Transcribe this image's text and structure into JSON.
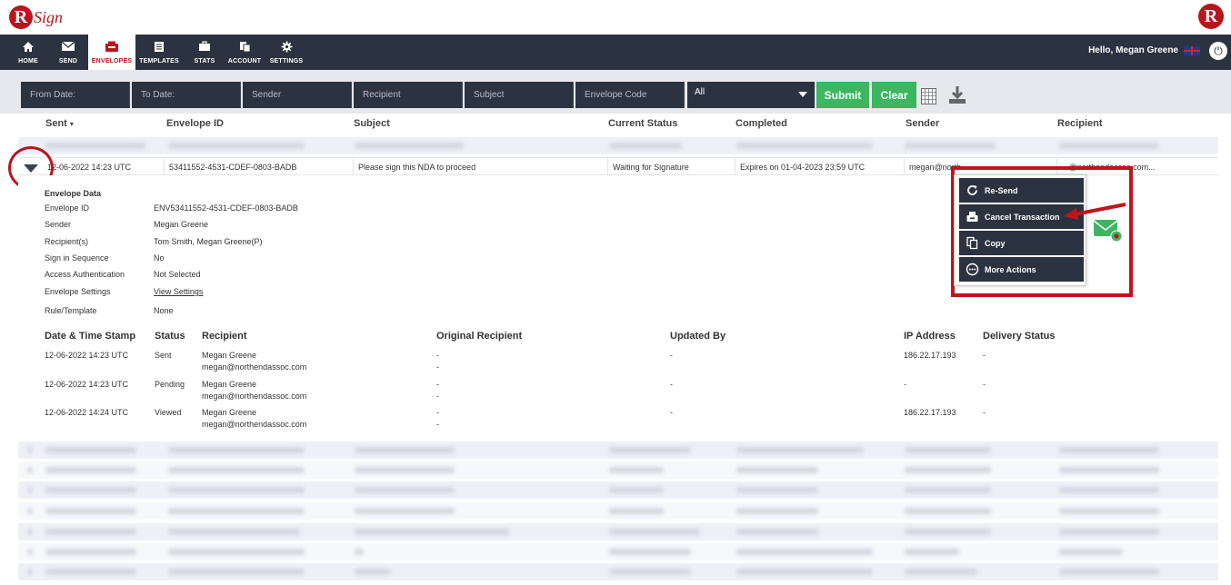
{
  "brand": {
    "logo_letter": "R",
    "logo_word": "Sign",
    "right_logo_letter": "R"
  },
  "nav": {
    "items": [
      {
        "label": "HOME",
        "icon": "home-icon"
      },
      {
        "label": "SEND",
        "icon": "envelope-icon"
      },
      {
        "label": "ENVELOPES",
        "icon": "inbox-icon"
      },
      {
        "label": "TEMPLATES",
        "icon": "document-icon"
      },
      {
        "label": "STATS",
        "icon": "briefcase-icon"
      },
      {
        "label": "ACCOUNT",
        "icon": "copy-icon"
      },
      {
        "label": "SETTINGS",
        "icon": "gear-icon"
      }
    ],
    "active_index": 2,
    "greeting": "Hello, Megan Greene"
  },
  "filters": {
    "from_date": "From Date:",
    "to_date": "To Date:",
    "sender": "Sender",
    "recipient": "Recipient",
    "subject": "Subject",
    "envelope_code": "Envelope Code",
    "status_select": "All",
    "submit_label": "Submit",
    "clear_label": "Clear"
  },
  "table": {
    "columns": [
      "Sent",
      "Envelope ID",
      "Subject",
      "Current Status",
      "Completed",
      "Sender",
      "Recipient"
    ],
    "row": {
      "sent": "12-06-2022 14:23 UTC",
      "envelope_id": "53411552-4531-CDEF-0803-BADB",
      "subject": "Please sign this NDA to proceed",
      "status": "Waiting for Signature",
      "completed": "Expires on 01-04-2023 23:59 UTC",
      "sender": "megan@north",
      "recipient": "...@northendassoc.com..."
    }
  },
  "envelope_data": {
    "title": "Envelope Data",
    "fields": [
      {
        "label": "Envelope ID",
        "value": "ENV53411552-4531-CDEF-0803-BADB"
      },
      {
        "label": "Sender",
        "value": "Megan Greene"
      },
      {
        "label": "Recipient(s)",
        "value": "Tom Smith, Megan Greene(P)"
      },
      {
        "label": "Sign in Sequence",
        "value": "No"
      },
      {
        "label": "Access Authentication",
        "value": "Not Selected"
      },
      {
        "label": "Envelope Settings",
        "value": "View Settings"
      },
      {
        "label": "Rule/Template",
        "value": "None"
      }
    ]
  },
  "history": {
    "columns": [
      "Date & Time Stamp",
      "Status",
      "Recipient",
      "Original Recipient",
      "Updated By",
      "IP Address",
      "Delivery Status"
    ],
    "rows": [
      {
        "time": "12-06-2022 14:23 UTC",
        "status": "Sent",
        "name": "Megan Greene",
        "email": "megan@northendassoc.com",
        "orig1": "-",
        "orig2": "-",
        "updated": "-",
        "ip": "186.22.17.193",
        "delivery": "-"
      },
      {
        "time": "12-06-2022 14:23 UTC",
        "status": "Pending",
        "name": "Megan Greene",
        "email": "megan@northendassoc.com",
        "orig1": "-",
        "orig2": "-",
        "updated": "-",
        "ip": "-",
        "delivery": "-"
      },
      {
        "time": "12-06-2022 14:24 UTC",
        "status": "Viewed",
        "name": "Megan Greene",
        "email": "megan@northendassoc.com",
        "orig1": "-",
        "orig2": "-",
        "updated": "-",
        "ip": "186.22.17.193",
        "delivery": "-"
      }
    ]
  },
  "context_menu": {
    "items": [
      {
        "label": "Re-Send",
        "icon": "refresh-icon"
      },
      {
        "label": "Cancel Transaction",
        "icon": "tray-icon"
      },
      {
        "label": "Copy",
        "icon": "copy-icon"
      },
      {
        "label": "More Actions",
        "icon": "more-icon"
      }
    ]
  },
  "colors": {
    "nav_bg": "#2c3340",
    "accent_red": "#b8161c",
    "green": "#3cb661",
    "highlight": "#c0141c"
  }
}
